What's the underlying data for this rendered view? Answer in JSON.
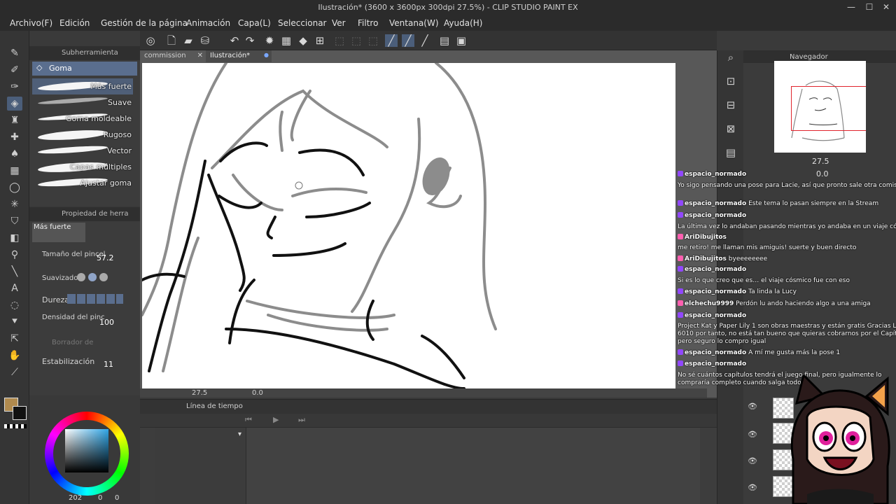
{
  "window": {
    "title": "Ilustración* (3600 x 3600px 300dpi 27.5%)  - CLIP STUDIO PAINT EX",
    "minimize": "—",
    "maximize": "☐",
    "close": "✕"
  },
  "menu": [
    "Archivo(F)",
    "Edición",
    "Gestión de la página",
    "Animación",
    "Capa(L)",
    "Seleccionar",
    "Ver",
    "Filtro",
    "Ventana(W)",
    "Ayuda(H)"
  ],
  "subtool_panel": {
    "title": "Subherramienta",
    "group": "Goma",
    "brushes": [
      "Más fuerte",
      "Suave",
      "Goma moldeable",
      "Rugoso",
      "Vector",
      "Capas múltiples",
      "Ajustar goma"
    ],
    "active_index": 0
  },
  "tool_property": {
    "title": "Propiedad de herra",
    "preset": "Más fuerte",
    "brush_size_label": "Tamaño del pincel",
    "brush_size": "57.2",
    "antialias_label": "Suavizado",
    "hardness_label": "Dureza",
    "density_label": "Densidad del pinc",
    "density": "100",
    "delete_vector_label": "Borrador de",
    "stabilization_label": "Estabilización",
    "stabilization": "11"
  },
  "color": {
    "main": "#b08a4e",
    "sub": "#111111",
    "hue_accent": "#31a7e8",
    "readout": "202",
    "readout2": "0",
    "readout3": "0"
  },
  "document_tabs": [
    {
      "label": "commission",
      "close": "✕"
    },
    {
      "label": "Ilustración*",
      "close": "●"
    }
  ],
  "canvas_status": {
    "zoom": "27.5",
    "angle": "0.0"
  },
  "timeline": {
    "title": "Línea de tiempo"
  },
  "navigator": {
    "title": "Navegador",
    "zoom": "27.5",
    "rotation": "0.0"
  },
  "chat": [
    {
      "user": "espacio_normado",
      "text": "",
      "color": "#e985ff"
    },
    {
      "user": "",
      "text": "Yo sigo pensando una pose para Lacie, así que pronto sale otra comisión",
      "color": ""
    },
    {
      "user": "espacio_normado",
      "text": "Este tema lo pasan siempre en la Stream",
      "color": "#e985ff"
    },
    {
      "user": "espacio_normado",
      "text": "",
      "color": "#e985ff"
    },
    {
      "user": "",
      "text": "La última vez lo andaban pasando mientras yo andaba en un viaje cósmico",
      "color": ""
    },
    {
      "user": "AriDibujitos",
      "text": "",
      "color": "#e985ff"
    },
    {
      "user": "",
      "text": "me retiro! me llaman mis amiguis! suerte y buen directo",
      "color": ""
    },
    {
      "user": "AriDibujitos",
      "text": "byeeeeeeee",
      "color": "#e985ff"
    },
    {
      "user": "espacio_normado",
      "text": "",
      "color": "#e985ff"
    },
    {
      "user": "",
      "text": "Si es lo que creo que es… el viaje cósmico fue con eso",
      "color": ""
    },
    {
      "user": "espacio_normado",
      "text": "Ta linda la Lucy",
      "color": "#e985ff"
    },
    {
      "user": "elchechu9999",
      "text": "Perdón lu ando haciendo algo a una amiga",
      "color": "#e985ff"
    },
    {
      "user": "espacio_normado",
      "text": "",
      "color": "#e985ff"
    },
    {
      "user": "",
      "text": "Project Kat y Paper Lily 1 son obras maestras y están gratis Gracias Leef",
      "color": ""
    },
    {
      "user": "",
      "text": "6010 por tanto, no está tan bueno que quieras cobrarnos por el Capítulo 2",
      "color": ""
    },
    {
      "user": "",
      "text": "pero seguro lo compro igual",
      "color": ""
    },
    {
      "user": "espacio_normado",
      "text": "A mí me gusta más la pose 1",
      "color": "#e985ff"
    },
    {
      "user": "espacio_normado",
      "text": "",
      "color": "#e985ff"
    },
    {
      "user": "",
      "text": "No sé cuántos capítulos tendrá el juego final, pero igualmente lo",
      "color": ""
    },
    {
      "user": "",
      "text": "compraría completo cuando salga todo",
      "color": ""
    }
  ]
}
